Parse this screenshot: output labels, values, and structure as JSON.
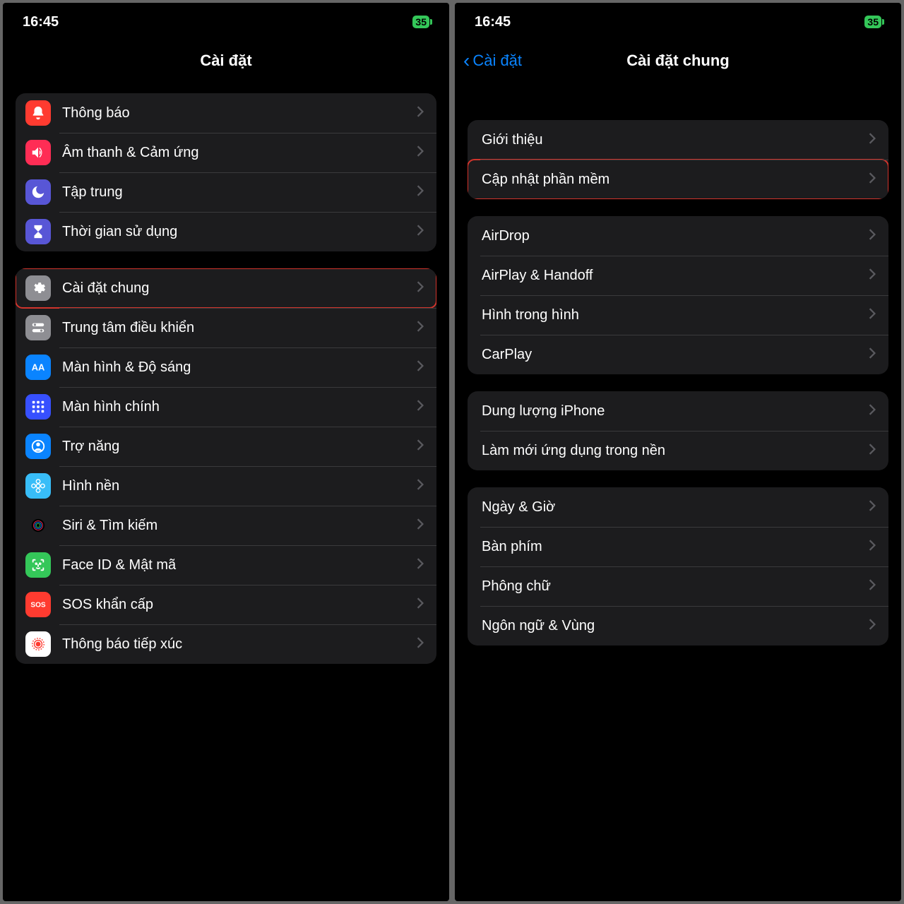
{
  "status": {
    "time": "16:45",
    "battery": "35"
  },
  "screen1": {
    "title": "Cài đặt",
    "groupA": [
      {
        "name": "notifications",
        "label": "Thông báo",
        "icon": "bell",
        "bg": "#ff3b30"
      },
      {
        "name": "sounds",
        "label": "Âm thanh & Cảm ứng",
        "icon": "speaker",
        "bg": "#ff2d55"
      },
      {
        "name": "focus",
        "label": "Tập trung",
        "icon": "moon",
        "bg": "#5856d6"
      },
      {
        "name": "screentime",
        "label": "Thời gian sử dụng",
        "icon": "hourglass",
        "bg": "#5856d6"
      }
    ],
    "groupB": [
      {
        "name": "general",
        "label": "Cài đặt chung",
        "icon": "gear",
        "bg": "#8e8e93",
        "highlight": true
      },
      {
        "name": "control-center",
        "label": "Trung tâm điều khiển",
        "icon": "switches",
        "bg": "#8e8e93"
      },
      {
        "name": "display",
        "label": "Màn hình & Độ sáng",
        "icon": "AA",
        "bg": "#0a84ff"
      },
      {
        "name": "home-screen",
        "label": "Màn hình chính",
        "icon": "grid",
        "bg": "#3750ff"
      },
      {
        "name": "accessibility",
        "label": "Trợ năng",
        "icon": "person",
        "bg": "#0a84ff"
      },
      {
        "name": "wallpaper",
        "label": "Hình nền",
        "icon": "flower",
        "bg": "#38bdf8"
      },
      {
        "name": "siri",
        "label": "Siri & Tìm kiếm",
        "icon": "siri",
        "bg": "#1c1c1e"
      },
      {
        "name": "faceid",
        "label": "Face ID & Mật mã",
        "icon": "faceid",
        "bg": "#34c759"
      },
      {
        "name": "sos",
        "label": "SOS khẩn cấp",
        "icon": "SOS",
        "bg": "#ff3b30"
      },
      {
        "name": "exposure",
        "label": "Thông báo tiếp xúc",
        "icon": "exposure",
        "bg": "#ffffff"
      }
    ]
  },
  "screen2": {
    "back": "Cài đặt",
    "title": "Cài đặt chung",
    "groupA": [
      {
        "name": "about",
        "label": "Giới thiệu"
      },
      {
        "name": "software-update",
        "label": "Cập nhật phần mềm",
        "highlight": true
      }
    ],
    "groupB": [
      {
        "name": "airdrop",
        "label": "AirDrop"
      },
      {
        "name": "airplay-handoff",
        "label": "AirPlay & Handoff"
      },
      {
        "name": "pip",
        "label": "Hình trong hình"
      },
      {
        "name": "carplay",
        "label": "CarPlay"
      }
    ],
    "groupC": [
      {
        "name": "iphone-storage",
        "label": "Dung lượng iPhone"
      },
      {
        "name": "background-refresh",
        "label": "Làm mới ứng dụng trong nền"
      }
    ],
    "groupD": [
      {
        "name": "date-time",
        "label": "Ngày & Giờ"
      },
      {
        "name": "keyboard",
        "label": "Bàn phím"
      },
      {
        "name": "fonts",
        "label": "Phông chữ"
      },
      {
        "name": "language-region",
        "label": "Ngôn ngữ & Vùng"
      }
    ]
  }
}
